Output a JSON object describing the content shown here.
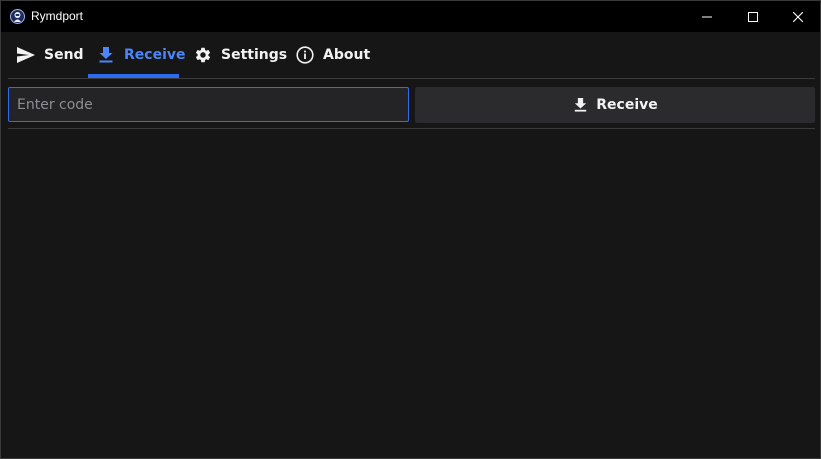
{
  "window": {
    "title": "Rymdport",
    "icons": {
      "app": "rymdport-astronaut-icon",
      "minimize": "minimize-icon",
      "maximize": "maximize-icon",
      "close": "close-icon"
    }
  },
  "tabs": [
    {
      "label": "Send",
      "icon": "send-icon",
      "active": false
    },
    {
      "label": "Receive",
      "icon": "download-icon",
      "active": true
    },
    {
      "label": "Settings",
      "icon": "gear-icon",
      "active": false
    },
    {
      "label": "About",
      "icon": "info-icon",
      "active": false
    }
  ],
  "receive": {
    "code_placeholder": "Enter code",
    "code_value": "",
    "button_label": "Receive",
    "button_icon": "download-icon"
  },
  "colors": {
    "accent": "#2f6bed",
    "active_tab_text": "#4a86f7",
    "background": "#161617",
    "titlebar": "#000000"
  }
}
